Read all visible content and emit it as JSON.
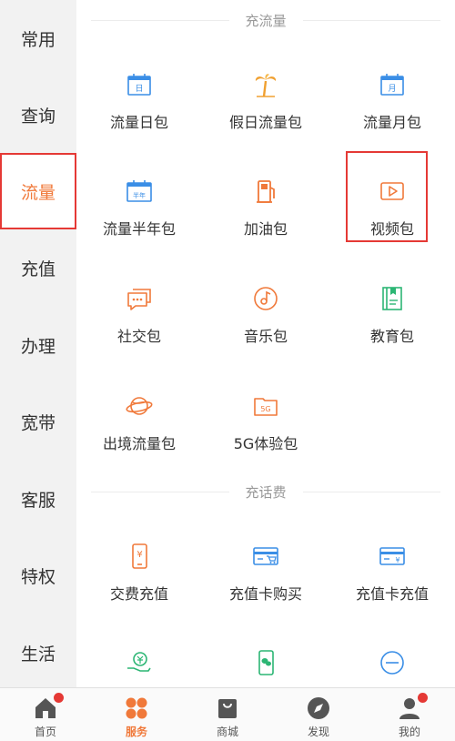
{
  "sidebar": {
    "items": [
      {
        "label": "常用",
        "active": false
      },
      {
        "label": "查询",
        "active": false
      },
      {
        "label": "流量",
        "active": true
      },
      {
        "label": "充值",
        "active": false
      },
      {
        "label": "办理",
        "active": false
      },
      {
        "label": "宽带",
        "active": false
      },
      {
        "label": "客服",
        "active": false
      },
      {
        "label": "特权",
        "active": false
      },
      {
        "label": "生活",
        "active": false
      }
    ]
  },
  "sections": {
    "flow": {
      "title": "充流量",
      "items": [
        {
          "label": "流量日包",
          "icon": "calendar-day-icon",
          "icon_text": "日"
        },
        {
          "label": "假日流量包",
          "icon": "palm-tree-icon"
        },
        {
          "label": "流量月包",
          "icon": "calendar-month-icon",
          "icon_text": "月"
        },
        {
          "label": "流量半年包",
          "icon": "calendar-halfyear-icon",
          "icon_text": "半年"
        },
        {
          "label": "加油包",
          "icon": "fuel-pump-icon"
        },
        {
          "label": "视频包",
          "icon": "video-play-icon"
        },
        {
          "label": "社交包",
          "icon": "chat-bubble-icon"
        },
        {
          "label": "音乐包",
          "icon": "music-disc-icon"
        },
        {
          "label": "教育包",
          "icon": "book-icon"
        },
        {
          "label": "出境流量包",
          "icon": "planet-icon"
        },
        {
          "label": "5G体验包",
          "icon": "folder-5g-icon",
          "icon_text": "5G"
        }
      ]
    },
    "fee": {
      "title": "充话费",
      "items": [
        {
          "label": "交费充值",
          "icon": "phone-yen-icon",
          "icon_text": "¥"
        },
        {
          "label": "充值卡购买",
          "icon": "card-cart-icon"
        },
        {
          "label": "充值卡充值",
          "icon": "card-yen-icon",
          "icon_text": "¥"
        }
      ]
    }
  },
  "tabbar": {
    "items": [
      {
        "label": "首页",
        "icon": "home-icon",
        "badge": true,
        "active": false
      },
      {
        "label": "服务",
        "icon": "services-grid-icon",
        "badge": false,
        "active": true
      },
      {
        "label": "商城",
        "icon": "shopping-bag-icon",
        "badge": false,
        "active": false
      },
      {
        "label": "发现",
        "icon": "compass-icon",
        "badge": false,
        "active": false
      },
      {
        "label": "我的",
        "icon": "user-icon",
        "badge": true,
        "active": false
      }
    ]
  },
  "colors": {
    "accent": "#f0793a",
    "highlight": "#e53935",
    "blue": "#3a8ee6",
    "green": "#2cb674"
  }
}
